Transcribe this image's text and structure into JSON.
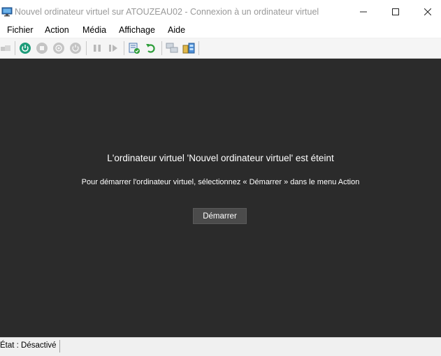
{
  "window": {
    "title": "Nouvel ordinateur virtuel sur ATOUZEAU02 - Connexion à un ordinateur virtuel",
    "app_icon": "vm-connection-monitor-icon",
    "controls": {
      "minimize": "–",
      "maximize": "☐",
      "close": "✕"
    }
  },
  "menu": {
    "items": [
      "Fichier",
      "Action",
      "Média",
      "Affichage",
      "Aide"
    ]
  },
  "toolbar": {
    "icons": [
      "ctrl-alt-del-icon",
      "start-icon",
      "turn-off-icon",
      "shut-down-icon",
      "save-icon",
      "pause-icon",
      "resume-icon",
      "checkpoint-icon",
      "revert-icon",
      "enhanced-session-icon",
      "share-icon"
    ]
  },
  "display": {
    "title": "L'ordinateur virtuel 'Nouvel ordinateur virtuel' est éteint",
    "subtitle": "Pour démarrer l'ordinateur virtuel, sélectionnez « Démarrer » dans le menu Action",
    "start_button": "Démarrer",
    "background": "#2b2b2b"
  },
  "status": {
    "text": "État : Désactivé"
  },
  "colors": {
    "accent_green": "#1e9c7a",
    "display_bg": "#2b2b2b"
  }
}
